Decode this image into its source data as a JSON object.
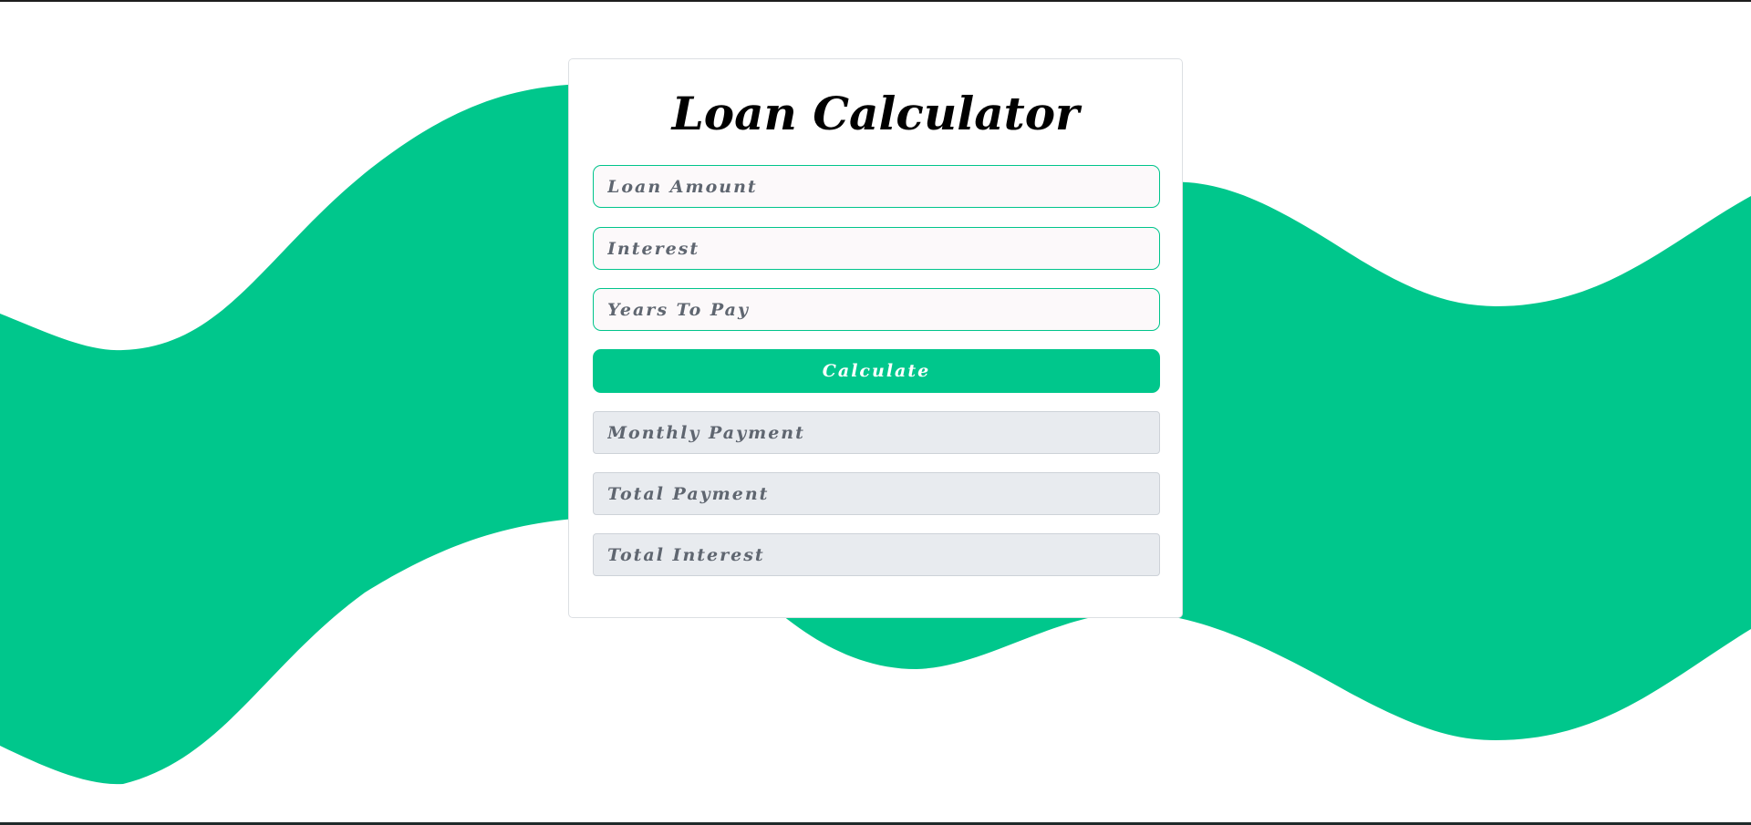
{
  "card": {
    "title": "Loan Calculator"
  },
  "inputs": {
    "loan_amount_placeholder": "Loan Amount",
    "interest_placeholder": "Interest",
    "years_placeholder": "Years To Pay"
  },
  "actions": {
    "calculate_label": "Calculate"
  },
  "outputs": {
    "monthly_payment_placeholder": "Monthly Payment",
    "total_payment_placeholder": "Total Payment",
    "total_interest_placeholder": "Total Interest"
  },
  "colors": {
    "accent": "#00C78C",
    "background": "#FFFFFF",
    "output_field": "#E8EBEF"
  }
}
